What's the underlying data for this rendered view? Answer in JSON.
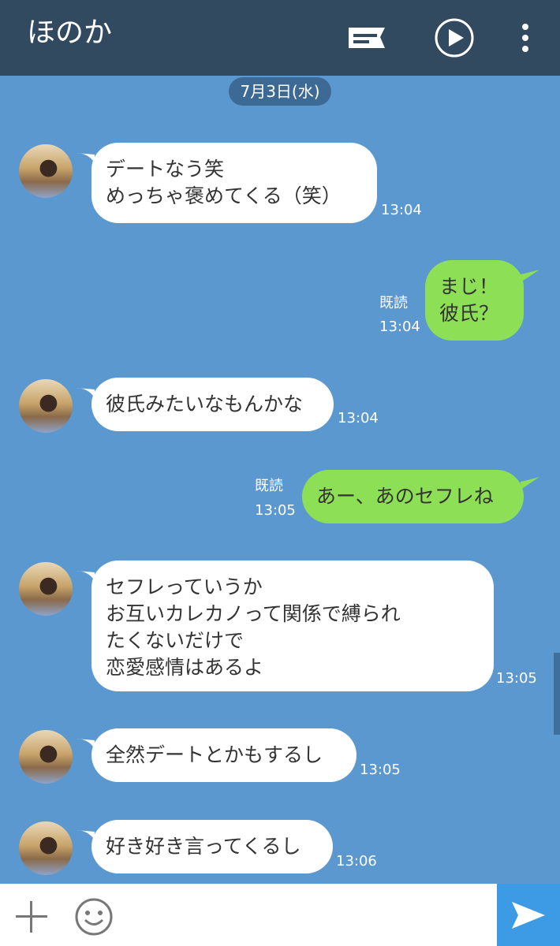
{
  "header": {
    "title": "ほのか",
    "icons": [
      "notes-icon",
      "play-icon",
      "more-icon"
    ]
  },
  "date_label": "7月3日(水)",
  "messages": [
    {
      "side": "them",
      "text": "デートなう笑\nめっちゃ褒めてくる（笑）",
      "time": "13:04"
    },
    {
      "side": "me",
      "text": "まじ！\n彼氏？",
      "read": "既読",
      "time": "13:04"
    },
    {
      "side": "them",
      "text": "彼氏みたいなもんかな",
      "time": "13:04"
    },
    {
      "side": "me",
      "text": "あー、あのセフレね",
      "read": "既読",
      "time": "13:05"
    },
    {
      "side": "them",
      "text": "セフレっていうか\nお互いカレカノって関係で縛られ\nたくないだけで\n恋愛感情はあるよ",
      "time": "13:05"
    },
    {
      "side": "them",
      "text": "全然デートとかもするし",
      "time": "13:05"
    },
    {
      "side": "them",
      "text": "好き好き言ってくるし",
      "time": "13:06"
    }
  ],
  "input": {
    "icons": [
      "plus-icon",
      "emoji-icon",
      "send-icon"
    ]
  },
  "colors": {
    "header_bg": "#324a60",
    "chat_bg": "#5a98cf",
    "my_bubble": "#8de055",
    "their_bubble": "#ffffff",
    "send_button": "#3d9be6"
  }
}
